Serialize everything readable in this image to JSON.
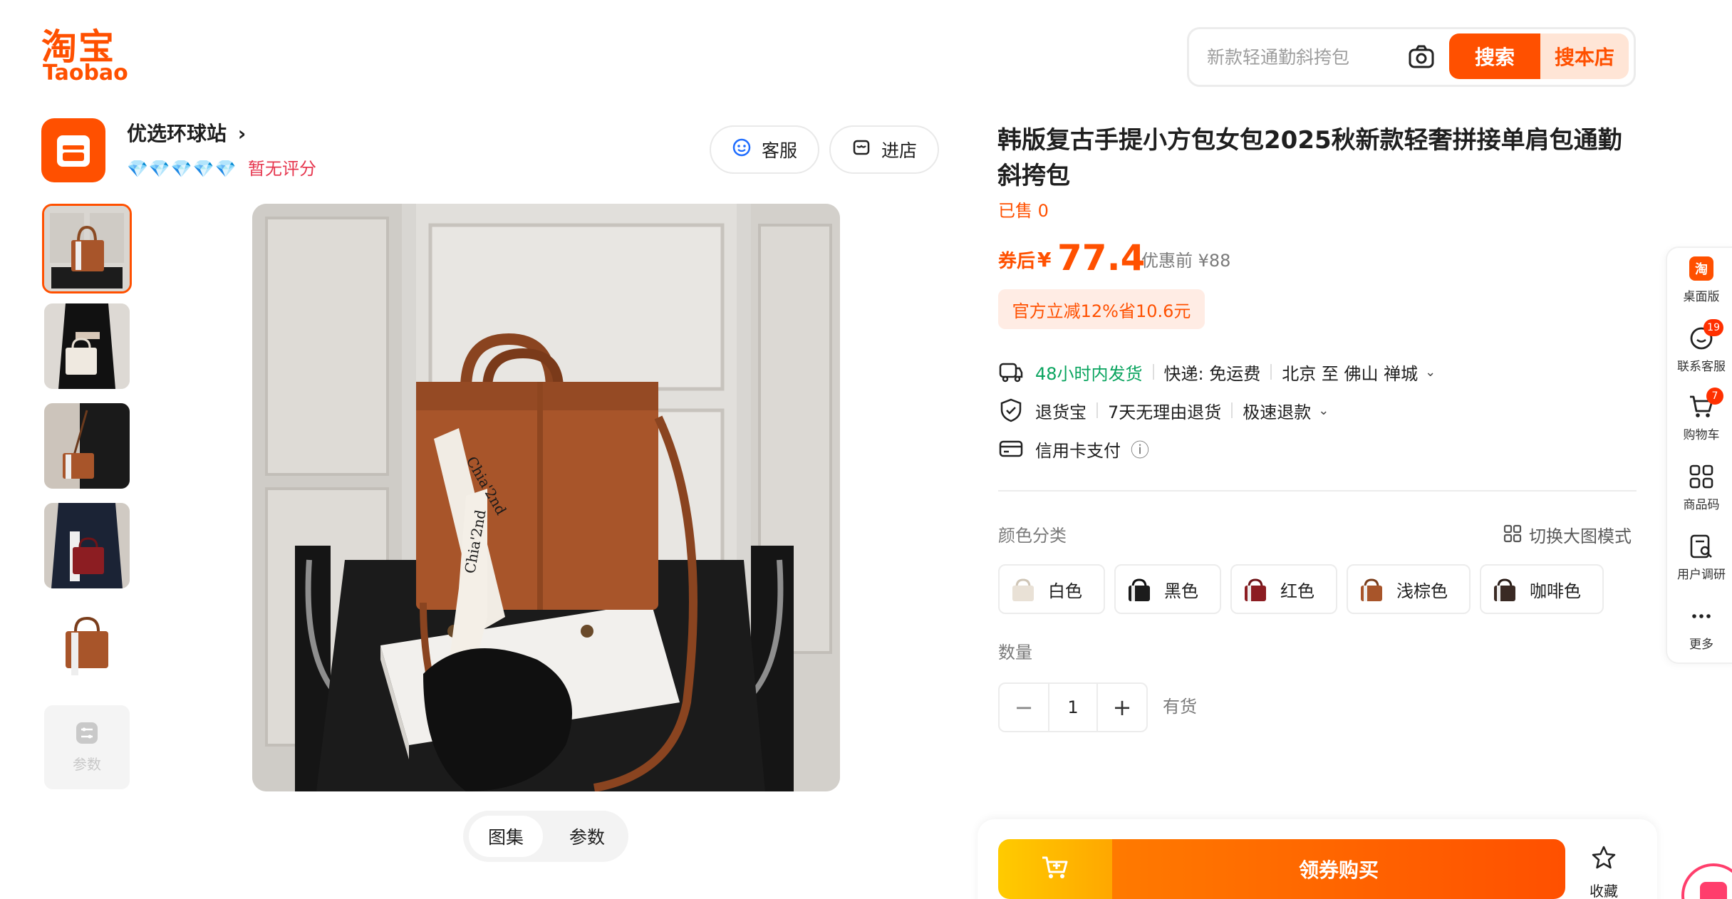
{
  "logo": {
    "cn": "淘宝",
    "en": "Taobao"
  },
  "search": {
    "placeholder": "新款轻通勤斜挎包",
    "search_label": "搜索",
    "store_search_label": "搜本店"
  },
  "shop": {
    "name": "优选环球站",
    "chevron": "›",
    "diamonds": "💎💎💎💎💎",
    "rating": "暂无评分",
    "service_label": "客服",
    "enter_store_label": "进店"
  },
  "gallery": {
    "thumb_count": 5,
    "params_label": "参数",
    "tabs": [
      {
        "label": "图集"
      },
      {
        "label": "参数"
      }
    ]
  },
  "product": {
    "title": "韩版复古手提小方包女包2025秋新款轻奢拼接单肩包通勤斜挎包",
    "sold": "已售 0",
    "price_prefix": "券后",
    "currency": "¥",
    "price": "77.4",
    "original_price": "优惠前 ¥88",
    "promo": "官方立减12%省10.6元"
  },
  "shipping": {
    "ship_time": "48小时内发货",
    "express": "快递: 免运费",
    "route": "北京 至 佛山 禅城",
    "chevron": "⌄"
  },
  "service": {
    "return_insurance": "退货宝",
    "no_reason_return": "7天无理由退货",
    "fast_refund": "极速退款",
    "chevron": "⌄"
  },
  "payment": {
    "credit_card": "信用卡支付",
    "info_icon": "ⓘ"
  },
  "sku": {
    "label": "颜色分类",
    "switch_mode": "切换大图模式",
    "options": [
      {
        "label": "白色",
        "color": "#e9e1d6"
      },
      {
        "label": "黑色",
        "color": "#1c1c1c"
      },
      {
        "label": "红色",
        "color": "#8c1d22"
      },
      {
        "label": "浅棕色",
        "color": "#a8552a"
      },
      {
        "label": "咖啡色",
        "color": "#3a2a24"
      }
    ]
  },
  "quantity": {
    "label": "数量",
    "minus": "−",
    "value": "1",
    "plus": "+",
    "stock": "有货"
  },
  "buy_bar": {
    "buy_label": "领券购买",
    "favorite_label": "收藏"
  },
  "sidebar": {
    "items": [
      {
        "label": "桌面版",
        "icon": "taobao-app-icon"
      },
      {
        "label": "联系客服",
        "icon": "chat-icon",
        "badge": "19"
      },
      {
        "label": "购物车",
        "icon": "cart-icon",
        "badge": "7"
      },
      {
        "label": "商品码",
        "icon": "qr-grid-icon"
      },
      {
        "label": "用户调研",
        "icon": "survey-icon"
      },
      {
        "label": "更多",
        "icon": "more-icon"
      }
    ]
  },
  "colors": {
    "brand": "#ff5000",
    "promo_bg": "#ffece4",
    "green": "#0aa45f",
    "rating": "#e6374f",
    "bag_brown": "#a8552a"
  }
}
